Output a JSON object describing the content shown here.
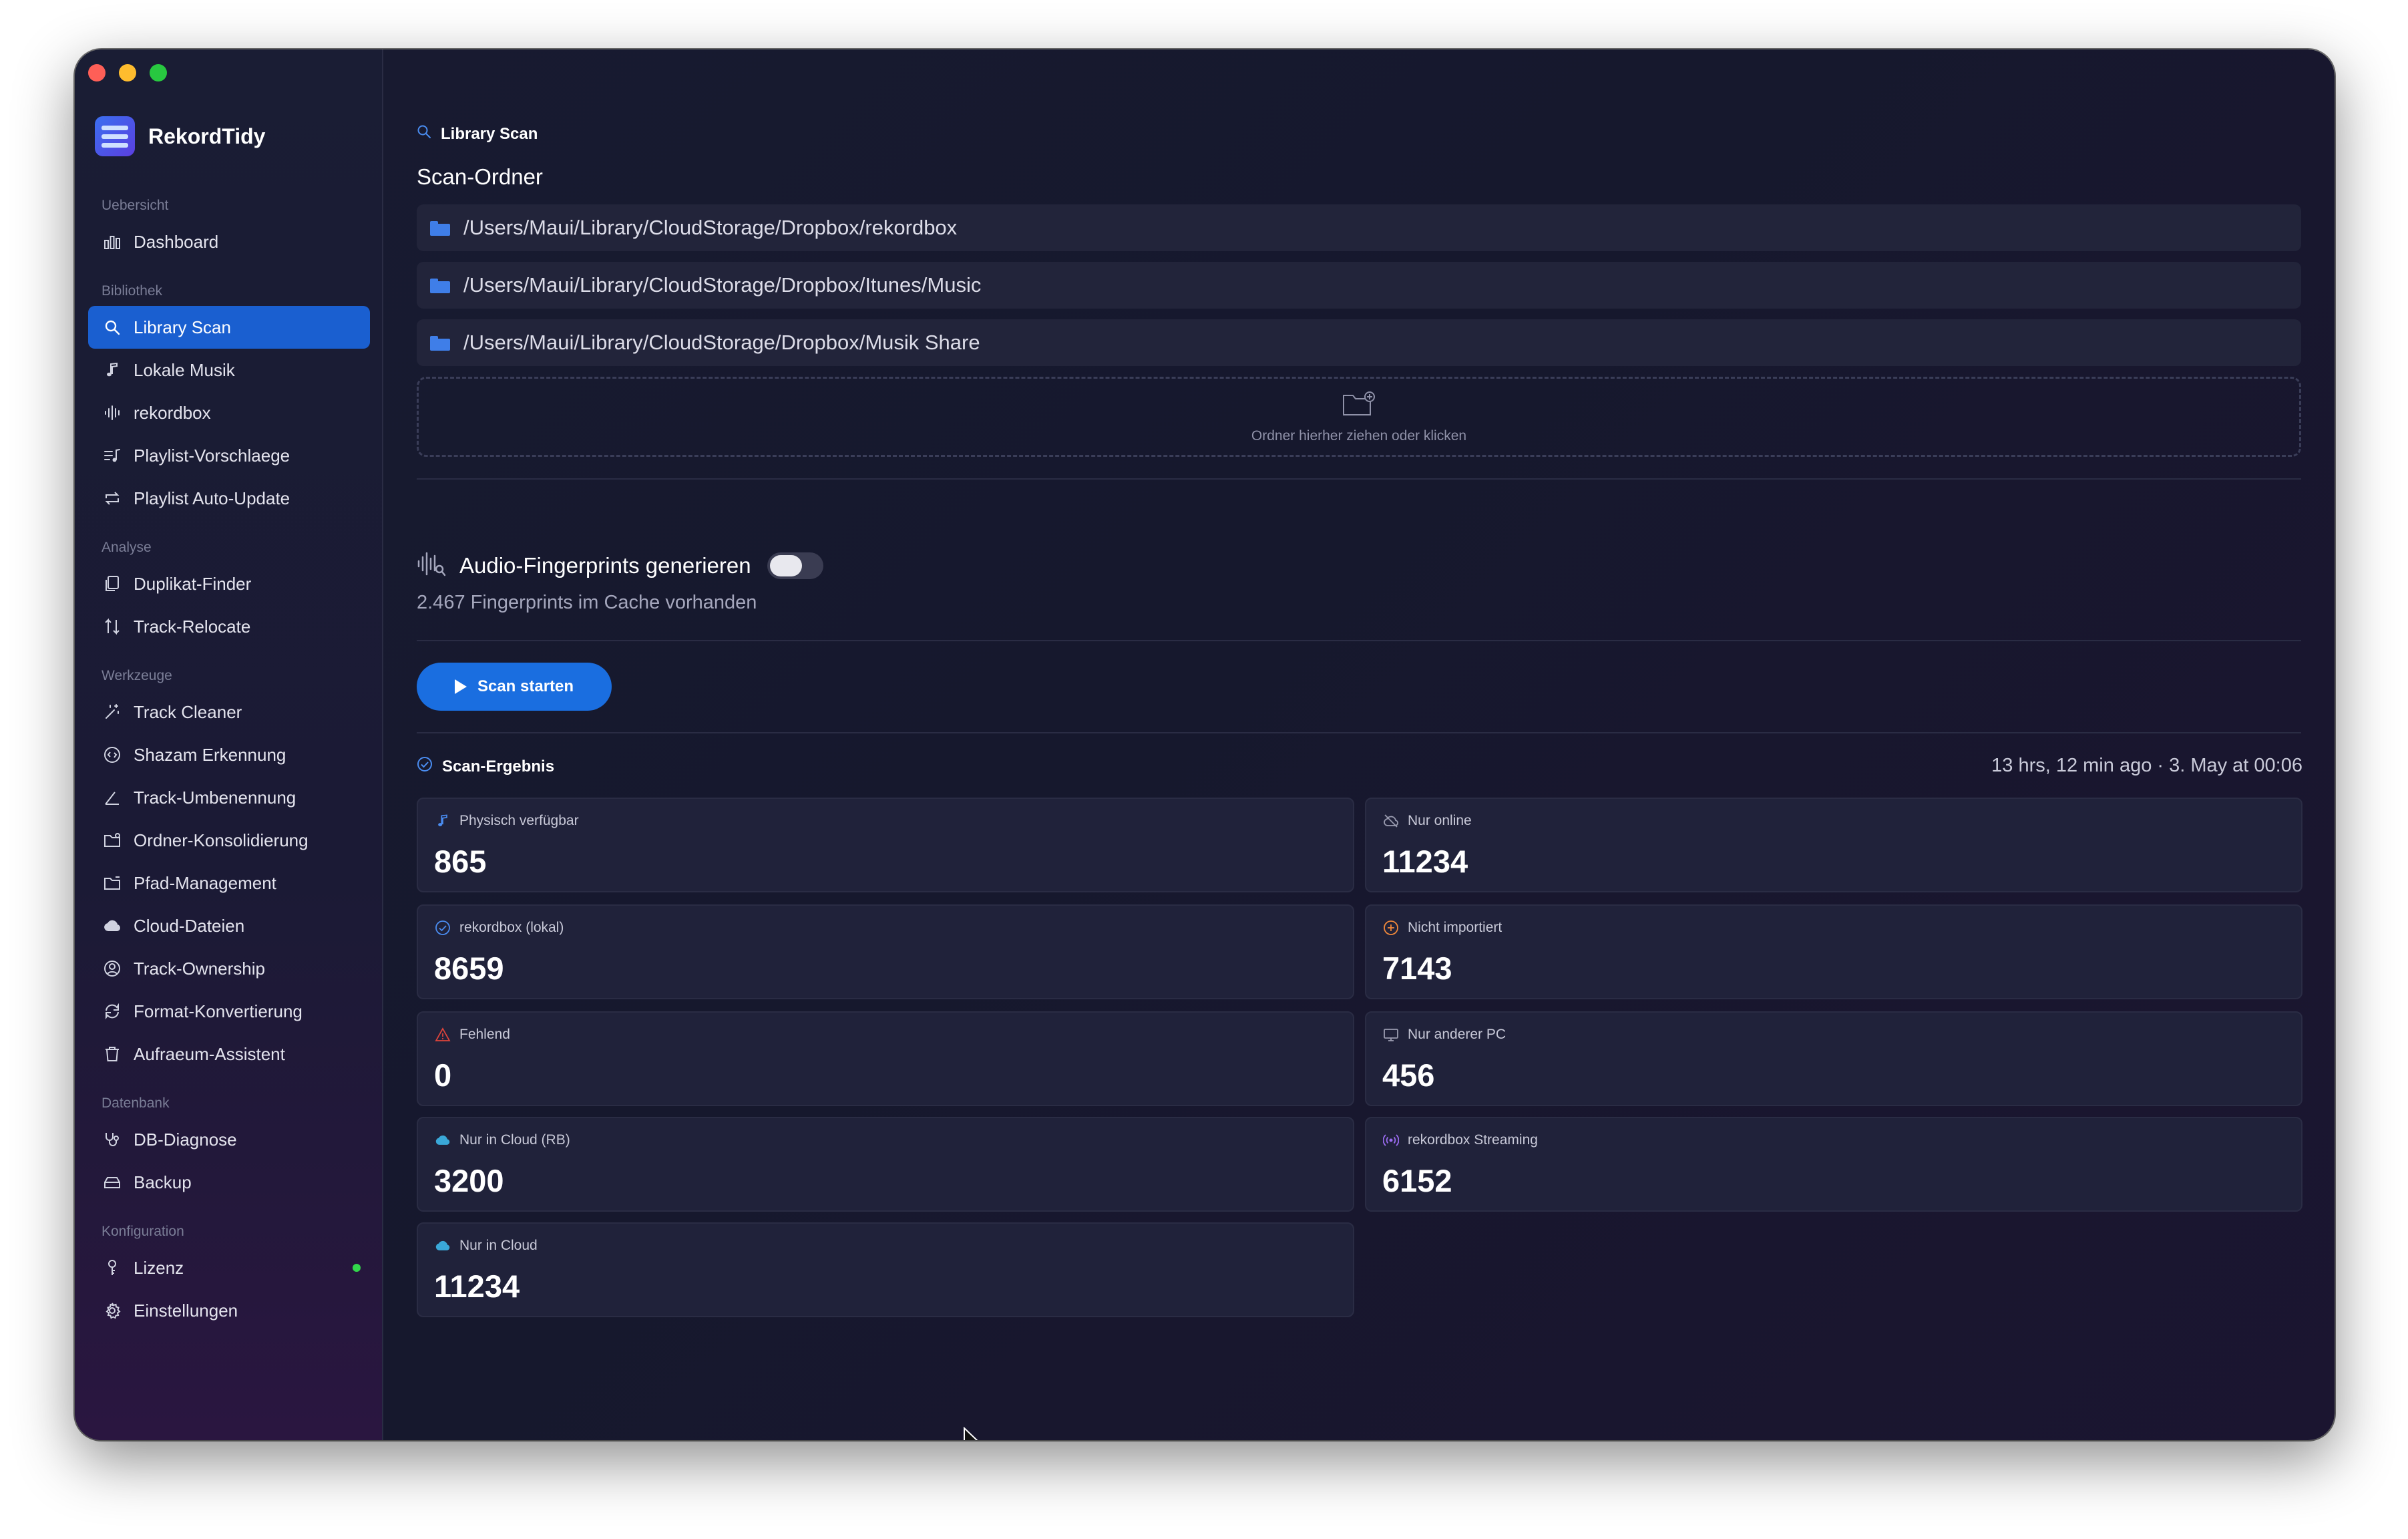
{
  "app": {
    "name": "RekordTidy"
  },
  "sidebar": {
    "sections": [
      {
        "title": "Uebersicht",
        "items": [
          {
            "label": "Dashboard",
            "icon": "bar-chart-icon"
          }
        ]
      },
      {
        "title": "Bibliothek",
        "items": [
          {
            "label": "Library Scan",
            "icon": "search-icon",
            "active": true
          },
          {
            "label": "Lokale Musik",
            "icon": "music-note-icon"
          },
          {
            "label": "rekordbox",
            "icon": "waveform-icon"
          },
          {
            "label": "Playlist-Vorschlaege",
            "icon": "playlist-icon"
          },
          {
            "label": "Playlist Auto-Update",
            "icon": "repeat-icon"
          }
        ]
      },
      {
        "title": "Analyse",
        "items": [
          {
            "label": "Duplikat-Finder",
            "icon": "duplicate-icon"
          },
          {
            "label": "Track-Relocate",
            "icon": "relocate-icon"
          }
        ]
      },
      {
        "title": "Werkzeuge",
        "items": [
          {
            "label": "Track Cleaner",
            "icon": "magic-wand-icon"
          },
          {
            "label": "Shazam Erkennung",
            "icon": "shazam-icon"
          },
          {
            "label": "Track-Umbenennung",
            "icon": "pencil-icon"
          },
          {
            "label": "Ordner-Konsolidierung",
            "icon": "folder-merge-icon"
          },
          {
            "label": "Pfad-Management",
            "icon": "folder-path-icon"
          },
          {
            "label": "Cloud-Dateien",
            "icon": "cloud-icon"
          },
          {
            "label": "Track-Ownership",
            "icon": "person-icon"
          },
          {
            "label": "Format-Konvertierung",
            "icon": "convert-icon"
          },
          {
            "label": "Aufraeum-Assistent",
            "icon": "trash-icon"
          }
        ]
      },
      {
        "title": "Datenbank",
        "items": [
          {
            "label": "DB-Diagnose",
            "icon": "stethoscope-icon"
          },
          {
            "label": "Backup",
            "icon": "backup-icon"
          }
        ]
      },
      {
        "title": "Konfiguration",
        "items": [
          {
            "label": "Lizenz",
            "icon": "key-icon",
            "status": "active"
          },
          {
            "label": "Einstellungen",
            "icon": "gear-icon"
          }
        ]
      }
    ]
  },
  "main": {
    "page_title": "Library Scan",
    "folders_title": "Scan-Ordner",
    "folders": [
      "/Users/Maui/Library/CloudStorage/Dropbox/rekordbox",
      "/Users/Maui/Library/CloudStorage/Dropbox/Itunes/Music",
      "/Users/Maui/Library/CloudStorage/Dropbox/Musik Share"
    ],
    "dropzone_text": "Ordner hierher ziehen oder klicken",
    "fingerprint_label": "Audio-Fingerprints generieren",
    "fingerprint_enabled": false,
    "fingerprint_cache": "2.467 Fingerprints im Cache vorhanden",
    "scan_button": "Scan starten",
    "result_title": "Scan-Ergebnis",
    "result_time": "13 hrs, 12 min ago  ·  3. May at 00:06",
    "stats": [
      {
        "label": "Physisch verfügbar",
        "value": "865",
        "icon": "music-note-icon",
        "color": "#4a8cf0"
      },
      {
        "label": "Nur online",
        "value": "11234",
        "icon": "cloud-off-icon",
        "color": "#9a9cb0"
      },
      {
        "label": "rekordbox (lokal)",
        "value": "8659",
        "icon": "check-circle-icon",
        "color": "#4a8cf0"
      },
      {
        "label": "Nicht importiert",
        "value": "7143",
        "icon": "plus-circle-icon",
        "color": "#f0883a"
      },
      {
        "label": "Fehlend",
        "value": "0",
        "icon": "warning-icon",
        "color": "#e0443a"
      },
      {
        "label": "Nur anderer PC",
        "value": "456",
        "icon": "monitor-icon",
        "color": "#9a9cb0"
      },
      {
        "label": "Nur in Cloud (RB)",
        "value": "3200",
        "icon": "cloud-icon",
        "color": "#3aa8d8"
      },
      {
        "label": "rekordbox Streaming",
        "value": "6152",
        "icon": "streaming-icon",
        "color": "#9a6cf0"
      },
      {
        "label": "Nur in Cloud",
        "value": "11234",
        "icon": "cloud-icon",
        "color": "#3aa8d8"
      }
    ]
  }
}
